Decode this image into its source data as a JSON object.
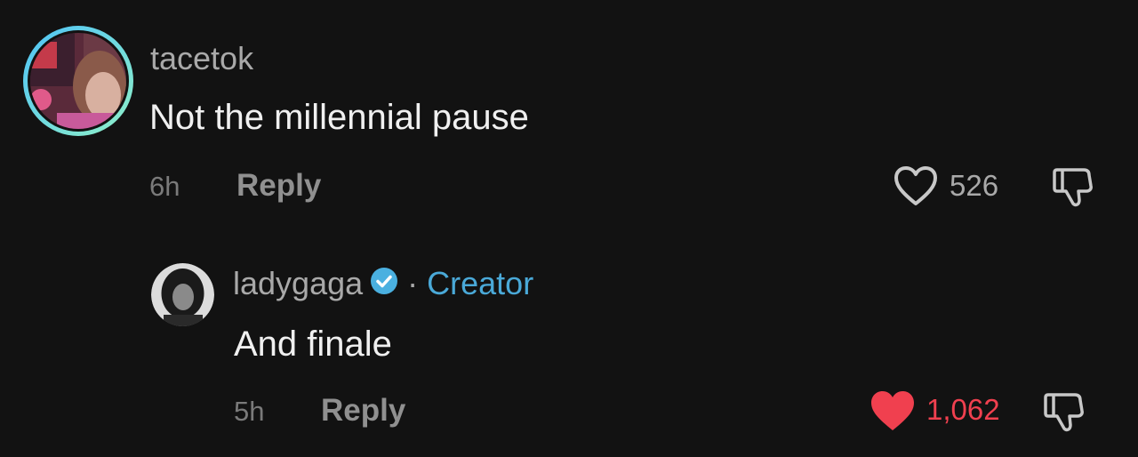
{
  "comments": [
    {
      "username": "tacetok",
      "text": "Not the millennial pause",
      "time": "6h",
      "reply_label": "Reply",
      "likes": "526",
      "liked": false
    }
  ],
  "reply": {
    "username": "ladygaga",
    "separator": "·",
    "creator_label": "Creator",
    "text": "And finale",
    "time": "5h",
    "reply_label": "Reply",
    "likes": "1,062",
    "liked": true
  },
  "colors": {
    "background": "#121212",
    "creator_accent": "#4aa9d8",
    "verified_badge": "#4ab0e0",
    "liked_heart": "#f0404f",
    "avatar_ring_start": "#4fc3f7",
    "avatar_ring_end": "#8ff0c8"
  },
  "icons": {
    "verified": "verified-check-icon",
    "like": "heart-icon",
    "dislike": "thumbs-down-icon"
  }
}
